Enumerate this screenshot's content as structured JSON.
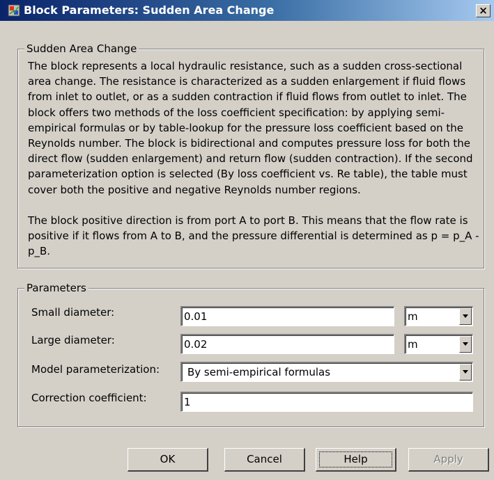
{
  "window": {
    "title": "Block Parameters: Sudden Area Change",
    "close_label": "×"
  },
  "description_group": {
    "legend": "Sudden Area Change",
    "paragraph1": "The block represents a local hydraulic resistance, such as a sudden cross-sectional area change. The resistance is characterized as a sudden enlargement if fluid flows from inlet to outlet, or as a sudden contraction if fluid flows from outlet to inlet. The block offers two methods of the loss coefficient specification: by applying semi-empirical formulas or by table-lookup for the pressure loss coefficient based on the Reynolds number. The block is bidirectional and computes pressure loss for both the direct flow (sudden enlargement) and return flow (sudden contraction). If the second parameterization option is selected (By loss coefficient vs. Re table), the table must cover both the positive and negative Reynolds number regions.",
    "paragraph2": "The block positive direction is from port A to port B. This means that the flow rate is positive if it flows from A to B, and the pressure differential is determined as p = p_A - p_B."
  },
  "parameters_group": {
    "legend": "Parameters",
    "small_diameter": {
      "label": "Small diameter:",
      "value": "0.01",
      "unit": "m"
    },
    "large_diameter": {
      "label": "Large diameter:",
      "value": "0.02",
      "unit": "m"
    },
    "model_parameterization": {
      "label": "Model parameterization:",
      "value": "By semi-empirical formulas"
    },
    "correction_coefficient": {
      "label": "Correction coefficient:",
      "value": "1"
    }
  },
  "buttons": {
    "ok": "OK",
    "cancel": "Cancel",
    "help": "Help",
    "apply": "Apply"
  },
  "colors": {
    "title_bar_start": "#0a246a",
    "title_bar_end": "#a6caf0",
    "dialog_face": "#d4d0c8"
  },
  "icons": {
    "app": "simulink-block-icon",
    "close": "close-icon",
    "dropdown": "chevron-down-icon"
  }
}
